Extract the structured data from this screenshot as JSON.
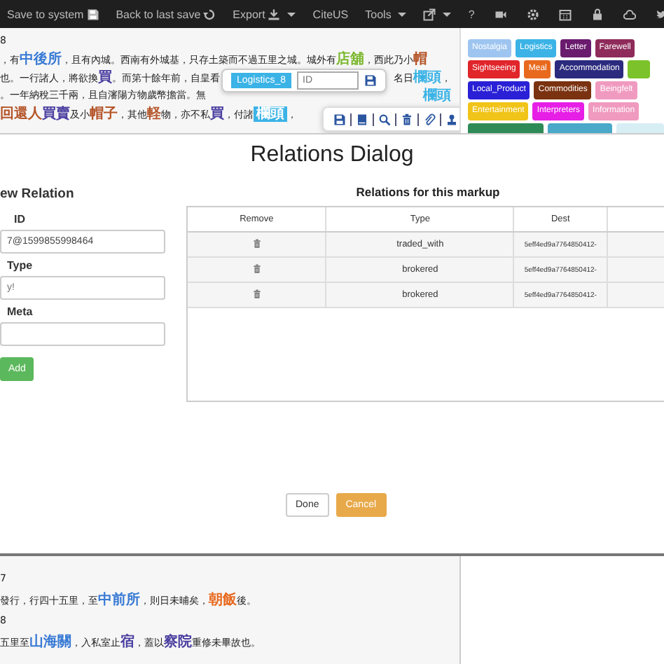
{
  "navbar": {
    "items": [
      {
        "label": "Save to system",
        "caret": false
      },
      {
        "label": "Back to last save",
        "caret": false
      },
      {
        "label": "Export",
        "caret": true
      },
      {
        "label": "CiteUS",
        "caret": false
      },
      {
        "label": "Tools",
        "caret": true
      },
      {
        "caret": true
      },
      {
        "label": "?",
        "caret": false
      }
    ]
  },
  "document_top": {
    "lines": [
      {
        "segments": [
          {
            "text": "8"
          }
        ]
      },
      {
        "segments": [
          {
            "text": "，有"
          },
          {
            "text": "中後所",
            "color": "#3a7bd5"
          },
          {
            "text": "，且有內城。西南有外城基，只存土築而不過五里之城。城外有"
          },
          {
            "text": "店舖",
            "color": "#7cb82f"
          },
          {
            "text": "，西此乃小"
          },
          {
            "text": "帽",
            "color": "#b5562a"
          }
        ]
      },
      {
        "segments": [
          {
            "text": "也。一行諸人，將欲換"
          },
          {
            "text": "買",
            "color": "#4a3fa0"
          },
          {
            "text": "。而第十餘年前，自皇看"
          }
        ],
        "after_popup": [
          {
            "text": "名日"
          },
          {
            "text": "欄頭",
            "color": "#3bb3e6"
          },
          {
            "text": "，"
          }
        ]
      },
      {
        "segments": [
          {
            "text": "。一年納稅三千兩，且自瀋陽方物歲幣擔當。無"
          }
        ],
        "after_popup": [
          {
            "text": "欄頭",
            "color": "#3bb3e6"
          }
        ]
      },
      {
        "segments": [
          {
            "text": "回還人",
            "color": "#b5562a"
          },
          {
            "text": "買賣",
            "color": "#4a3fa0"
          },
          {
            "text": "及小"
          },
          {
            "text": "帽子",
            "color": "#b5562a"
          },
          {
            "text": "，其他"
          },
          {
            "text": "軽",
            "color": "#b5562a"
          },
          {
            "text": "物，亦不私"
          },
          {
            "text": "買",
            "color": "#4a3fa0"
          },
          {
            "text": "，付諸"
          },
          {
            "text": "欄頭",
            "color": "#3bb3e6",
            "selected": true
          },
          {
            "text": "，"
          }
        ]
      }
    ]
  },
  "markup_popup": {
    "label": "Logistics_8",
    "id_placeholder": "ID"
  },
  "tag_rows": [
    [
      {
        "label": "Nostalgia",
        "color": "#9ec5f0"
      },
      {
        "label": "Logistics",
        "color": "#3bb3e6"
      },
      {
        "label": "Letter",
        "color": "#6a1b6e"
      },
      {
        "label": "Farewell",
        "color": "#8e2b5a"
      }
    ],
    [
      {
        "label": "Sightseeing",
        "color": "#e0252b"
      },
      {
        "label": "Meal",
        "color": "#e8691e"
      },
      {
        "label": "Accommodation",
        "color": "#2b2a7e"
      },
      {
        "color": "#7cc22a"
      }
    ],
    [
      {
        "label": "Local_Product",
        "color": "#2a20d6"
      },
      {
        "label": "Commodities",
        "color": "#7a3210"
      },
      {
        "label": "Beingfelt",
        "color": "#f19ac0"
      }
    ],
    [
      {
        "label": "Entertainment",
        "color": "#f0c419"
      },
      {
        "label": "Interpreters",
        "color": "#e61ee6"
      },
      {
        "label": "Information",
        "color": "#f09ac0"
      }
    ],
    [
      {
        "color": "#2e8b57"
      },
      {
        "color": "#4aa9c9"
      },
      {
        "color": "#d8eef5"
      }
    ]
  ],
  "dialog": {
    "title": "Relations Dialog",
    "new_relation": {
      "heading": "ew Relation",
      "fields": [
        {
          "label": "ID",
          "value": "7@1599855998464"
        },
        {
          "label": "Type",
          "placeholder": "y!"
        },
        {
          "label": "Meta"
        }
      ],
      "add_button": "Add"
    },
    "relations": {
      "heading": "Relations for this markup",
      "columns": [
        "Remove",
        "Type",
        "Dest"
      ],
      "rows": [
        {
          "type": "traded_with",
          "dest": "5eff4ed9a7764850412-"
        },
        {
          "type": "brokered",
          "dest": "5eff4ed9a7764850412-"
        },
        {
          "type": "brokered",
          "dest": "5eff4ed9a7764850412-"
        }
      ]
    },
    "buttons": [
      {
        "label": "Done",
        "kind": "default"
      },
      {
        "label": "Cancel",
        "kind": "warning"
      }
    ]
  },
  "document_bottom": {
    "lines": [
      {
        "segments": [
          {
            "text": "7"
          }
        ]
      },
      {
        "segments": [
          {
            "text": "發行，行四十五里，至"
          },
          {
            "text": "中前所",
            "color": "#3a7bd5"
          },
          {
            "text": "，則日未晡矣，"
          },
          {
            "text": "朝飯",
            "color": "#e8691e"
          },
          {
            "text": "後。"
          }
        ]
      },
      {
        "segments": [
          {
            "text": "8"
          }
        ]
      },
      {
        "segments": [
          {
            "text": "五里至"
          },
          {
            "text": "山海關",
            "color": "#3a7bd5"
          },
          {
            "text": "，入私室止"
          },
          {
            "text": "宿",
            "color": "#4a3fa0"
          },
          {
            "text": "，蓋以"
          },
          {
            "text": "察院",
            "color": "#4a3fa0"
          },
          {
            "text": "重修未畢故也。"
          }
        ]
      }
    ]
  }
}
